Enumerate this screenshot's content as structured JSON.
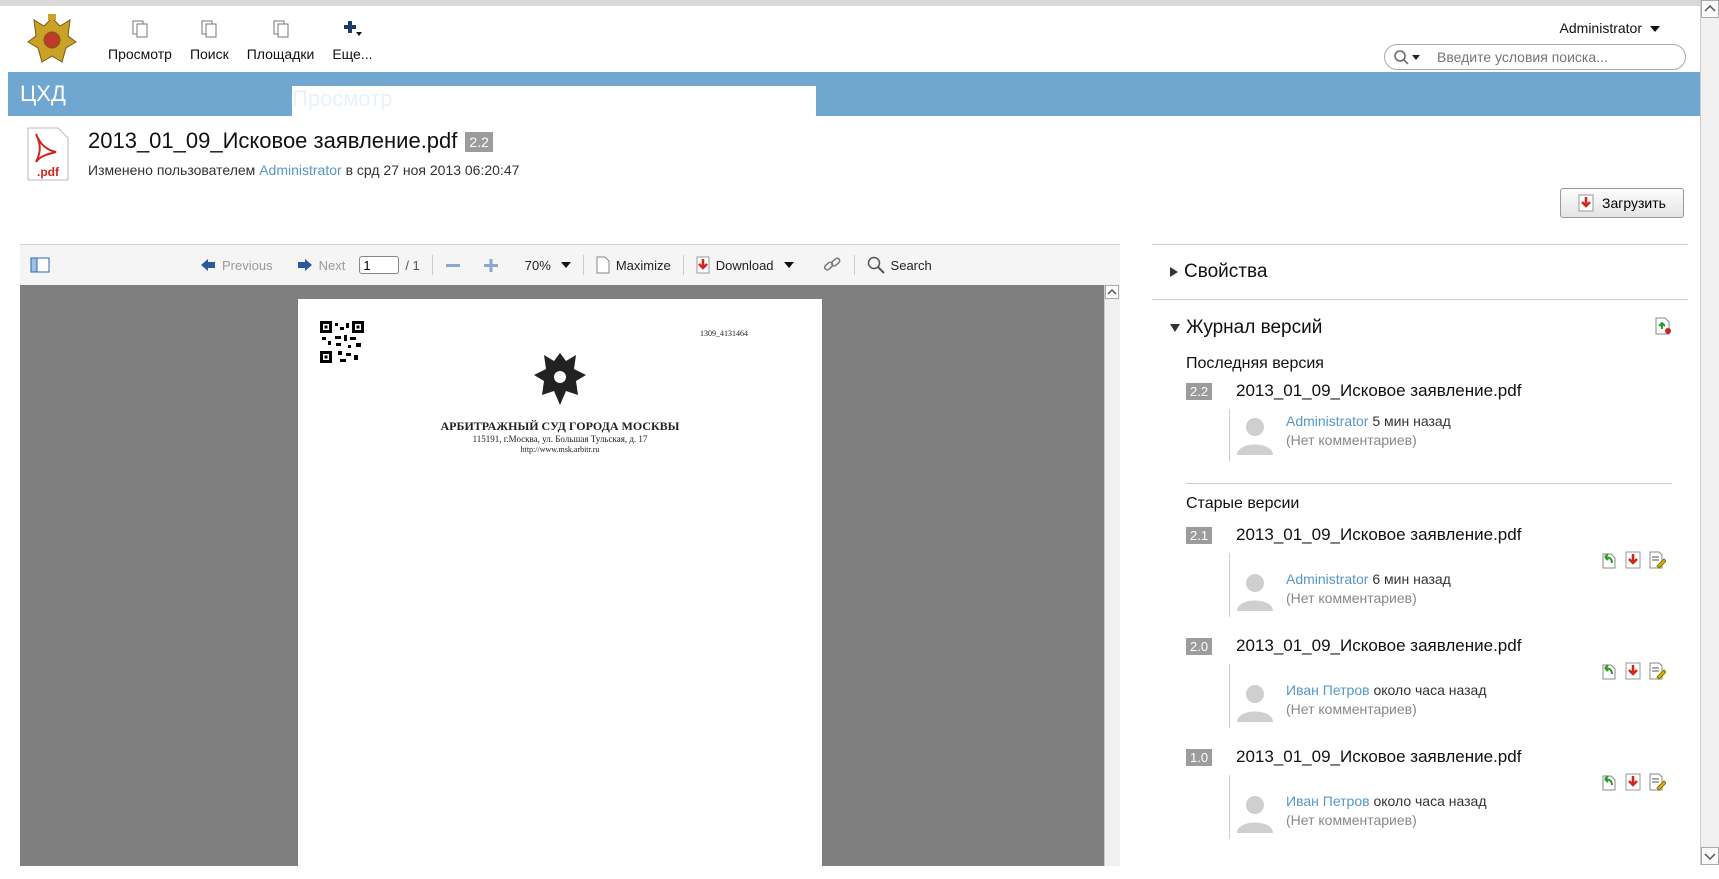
{
  "nav": {
    "items": [
      {
        "label": "Просмотр"
      },
      {
        "label": "Поиск"
      },
      {
        "label": "Площадки"
      },
      {
        "label": "Еще..."
      }
    ]
  },
  "user": {
    "name": "Administrator"
  },
  "search": {
    "placeholder": "Введите условия поиска..."
  },
  "band": {
    "site": "ЦХД",
    "page": "Просмотр"
  },
  "document": {
    "title": "2013_01_09_Исковое заявление.pdf",
    "version": "2.2",
    "icon_label": ".pdf",
    "meta_prefix": "Изменено пользователем",
    "meta_user": "Administrator",
    "meta_suffix": "в срд 27 ноя 2013 06:20:47"
  },
  "upload": {
    "label": "Загрузить"
  },
  "viewer": {
    "previous": "Previous",
    "next": "Next",
    "page_value": "1",
    "page_total": "/ 1",
    "zoom": "70%",
    "maximize": "Maximize",
    "download": "Download",
    "search": "Search"
  },
  "page": {
    "ref": "1309_4131464",
    "court_name": "АРБИТРАЖНЫЙ СУД ГОРОДА МОСКВЫ",
    "court_address": "115191, г.Москва, ул. Большая Тульская, д. 17",
    "court_url": "http://www.msk.arbitr.ru"
  },
  "side": {
    "properties": "Свойства",
    "history": "Журнал версий",
    "latest_title": "Последняя версия",
    "older_title": "Старые версии",
    "latest": {
      "version": "2.2",
      "name": "2013_01_09_Исковое заявление.pdf",
      "user": "Administrator",
      "time": "5 мин назад",
      "comment": "(Нет комментариев)"
    },
    "older": [
      {
        "version": "2.1",
        "name": "2013_01_09_Исковое заявление.pdf",
        "user": "Administrator",
        "time": "6 мин назад",
        "comment": "(Нет комментариев)"
      },
      {
        "version": "2.0",
        "name": "2013_01_09_Исковое заявление.pdf",
        "user": "Иван Петров",
        "time": "около часа назад",
        "comment": "(Нет комментариев)"
      },
      {
        "version": "1.0",
        "name": "2013_01_09_Исковое заявление.pdf",
        "user": "Иван Петров",
        "time": "около часа назад",
        "comment": "(Нет комментариев)"
      }
    ]
  },
  "colors": {
    "band": "#6fa7d0",
    "link": "#5597c8",
    "badge": "#9c9c9c",
    "viewer_bg": "#7f7f7f"
  }
}
